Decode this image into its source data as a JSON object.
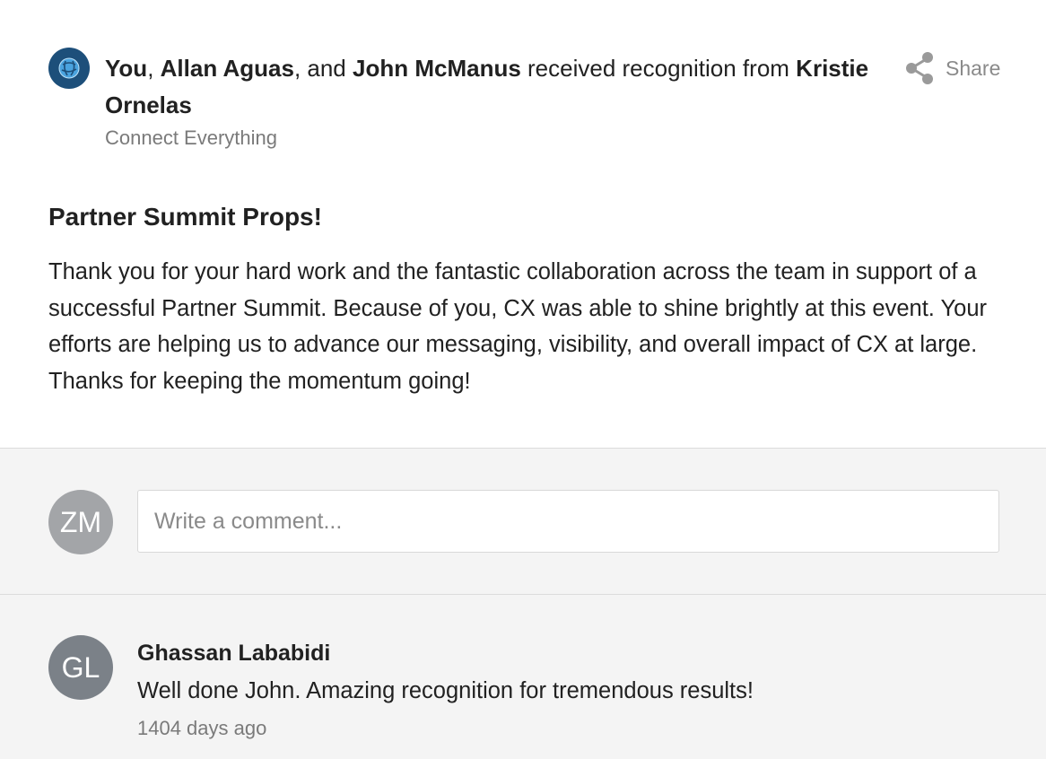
{
  "post": {
    "recipients": [
      {
        "name": "You",
        "sep": ", "
      },
      {
        "name": "Allan Aguas",
        "sep": ", and "
      },
      {
        "name": "John McManus",
        "sep": ""
      }
    ],
    "verb": " received recognition from ",
    "giver": "Kristie Ornelas",
    "subtitle": "Connect Everything",
    "share_label": "Share",
    "title": "Partner Summit Props!",
    "message": "Thank you for your hard work and the fantastic collaboration across the team in support of a successful Partner Summit. Because of you, CX was able to shine brightly at this event. Your efforts are helping us to advance our messaging, visibility, and overall impact of CX at large. Thanks for keeping the momentum going!",
    "badge_icon": "globe-icon"
  },
  "composer": {
    "avatar_initials": "ZM",
    "placeholder": "Write a comment...",
    "value": ""
  },
  "comments": [
    {
      "initials": "GL",
      "author": "Ghassan Lababidi",
      "text": "Well done John. Amazing recognition for tremendous results!",
      "time": "1404 days ago"
    }
  ],
  "colors": {
    "badge": "#1d4f7a",
    "badge_accent": "#4aa3df",
    "muted_text": "#7a7a7a",
    "section_bg": "#f4f4f4"
  }
}
